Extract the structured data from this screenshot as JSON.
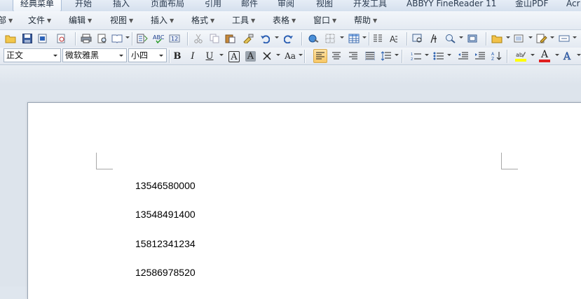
{
  "ribbon_tabs": [
    {
      "label": "经典菜单",
      "active": true
    },
    {
      "label": "开始"
    },
    {
      "label": "插入"
    },
    {
      "label": "页面布局"
    },
    {
      "label": "引用"
    },
    {
      "label": "邮件"
    },
    {
      "label": "审阅"
    },
    {
      "label": "视图"
    },
    {
      "label": "开发工具"
    },
    {
      "label": "ABBYY FineReader 11"
    },
    {
      "label": "金山PDF"
    },
    {
      "label": "Acr"
    }
  ],
  "menu": [
    "部",
    "文件",
    "编辑",
    "视图",
    "插入",
    "格式",
    "工具",
    "表格",
    "窗口",
    "帮助"
  ],
  "format_bar": {
    "style": "正文",
    "font": "微软雅黑",
    "size": "小四",
    "bold": "B",
    "italic": "I",
    "underline": "U",
    "char_border": "A",
    "char_shading": "A",
    "change_case": "Aa",
    "font_color_label": "A",
    "font_color": "#e02020",
    "highlight_color": "#ffff00"
  },
  "document": {
    "lines": [
      "13546580000",
      "13548491400",
      "15812341234",
      "12586978520"
    ]
  }
}
